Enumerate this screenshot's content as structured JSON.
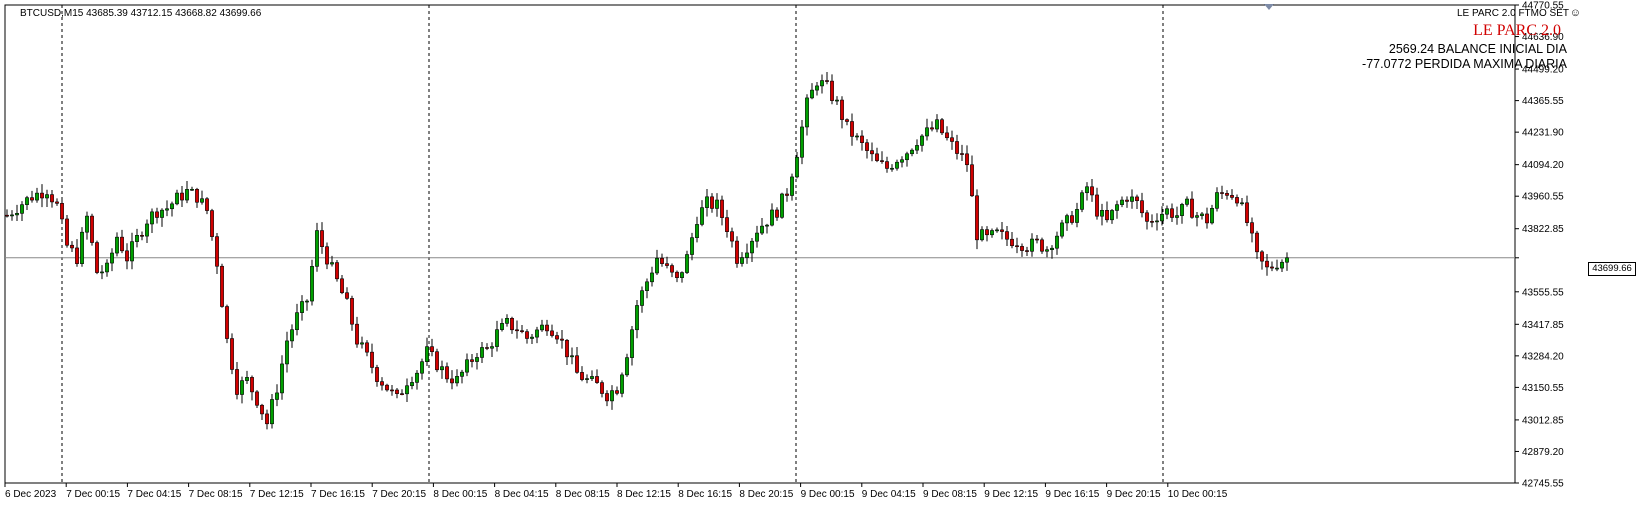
{
  "header": {
    "symbol_info": "BTCUSD,M15  43685.39 43712.15 43668.82 43699.66",
    "ea_label": "LE PARC 2.0 FTMO SET",
    "ea_title": "LE PARC 2.0",
    "balance_line": "2569.24 BALANCE INICIAL DIA",
    "loss_line": "-77.0772 PERDIDA MAXIMA DIARIA",
    "smiley_icon": "smiley-face-icon"
  },
  "colors": {
    "bull": "#00a000",
    "bear": "#d10000",
    "wick": "#000000",
    "grid": "#000000",
    "current_price_line": "#888888",
    "ea_title": "#d10000"
  },
  "chart_data": {
    "type": "candlestick",
    "symbol": "BTCUSD",
    "timeframe": "M15",
    "ylim": [
      42745.55,
      44770.55
    ],
    "y_ticks": [
      "44770.55",
      "44636.90",
      "44499.20",
      "44365.55",
      "44231.90",
      "44094.20",
      "43960.55",
      "43822.85",
      "43699.66",
      "43555.55",
      "43417.85",
      "43284.20",
      "43150.55",
      "43012.85",
      "42879.20",
      "42745.55"
    ],
    "x_tick_labels": [
      "6 Dec 2023",
      "7 Dec 00:15",
      "7 Dec 04:15",
      "7 Dec 08:15",
      "7 Dec 12:15",
      "7 Dec 16:15",
      "7 Dec 20:15",
      "8 Dec 00:15",
      "8 Dec 04:15",
      "8 Dec 08:15",
      "8 Dec 12:15",
      "8 Dec 16:15",
      "8 Dec 20:15",
      "9 Dec 00:15",
      "9 Dec 04:15",
      "9 Dec 08:15",
      "9 Dec 12:15",
      "9 Dec 16:15",
      "9 Dec 20:15",
      "10 Dec 00:15"
    ],
    "day_separators": [
      "7 Dec 00:00",
      "8 Dec 00:00",
      "9 Dec 00:00",
      "10 Dec 00:00"
    ],
    "current_price": 43699.66,
    "grid": false,
    "close_path": [
      [
        0,
        43880
      ],
      [
        3,
        43930
      ],
      [
        5,
        43960
      ],
      [
        8,
        43990
      ],
      [
        10,
        43920
      ],
      [
        12,
        43750
      ],
      [
        14,
        43700
      ],
      [
        16,
        43870
      ],
      [
        18,
        43640
      ],
      [
        20,
        43650
      ],
      [
        22,
        43790
      ],
      [
        24,
        43700
      ],
      [
        26,
        43780
      ],
      [
        28,
        43860
      ],
      [
        30,
        43900
      ],
      [
        32,
        43910
      ],
      [
        34,
        43950
      ],
      [
        36,
        43980
      ],
      [
        38,
        43960
      ],
      [
        40,
        43900
      ],
      [
        42,
        43680
      ],
      [
        44,
        43350
      ],
      [
        46,
        43150
      ],
      [
        48,
        43180
      ],
      [
        50,
        43100
      ],
      [
        52,
        43000
      ],
      [
        54,
        43150
      ],
      [
        56,
        43350
      ],
      [
        58,
        43450
      ],
      [
        60,
        43520
      ],
      [
        62,
        43800
      ],
      [
        64,
        43700
      ],
      [
        66,
        43600
      ],
      [
        68,
        43500
      ],
      [
        70,
        43350
      ],
      [
        72,
        43280
      ],
      [
        74,
        43200
      ],
      [
        76,
        43150
      ],
      [
        78,
        43100
      ],
      [
        80,
        43180
      ],
      [
        82,
        43220
      ],
      [
        84,
        43300
      ],
      [
        86,
        43250
      ],
      [
        88,
        43200
      ],
      [
        90,
        43180
      ],
      [
        92,
        43240
      ],
      [
        94,
        43300
      ],
      [
        96,
        43310
      ],
      [
        98,
        43380
      ],
      [
        100,
        43420
      ],
      [
        102,
        43400
      ],
      [
        104,
        43360
      ],
      [
        106,
        43390
      ],
      [
        108,
        43420
      ],
      [
        110,
        43380
      ],
      [
        112,
        43300
      ],
      [
        114,
        43210
      ],
      [
        116,
        43180
      ],
      [
        118,
        43160
      ],
      [
        120,
        43120
      ],
      [
        122,
        43150
      ],
      [
        124,
        43300
      ],
      [
        126,
        43500
      ],
      [
        128,
        43600
      ],
      [
        130,
        43700
      ],
      [
        132,
        43650
      ],
      [
        134,
        43600
      ],
      [
        136,
        43700
      ],
      [
        138,
        43870
      ],
      [
        140,
        43930
      ],
      [
        142,
        43920
      ],
      [
        144,
        43830
      ],
      [
        146,
        43700
      ],
      [
        148,
        43750
      ],
      [
        150,
        43820
      ],
      [
        152,
        43860
      ],
      [
        154,
        43900
      ],
      [
        156,
        43980
      ],
      [
        158,
        44150
      ],
      [
        160,
        44350
      ],
      [
        162,
        44450
      ],
      [
        164,
        44420
      ],
      [
        166,
        44350
      ],
      [
        168,
        44250
      ],
      [
        170,
        44200
      ],
      [
        172,
        44150
      ],
      [
        174,
        44100
      ],
      [
        176,
        44080
      ],
      [
        178,
        44120
      ],
      [
        180,
        44150
      ],
      [
        182,
        44200
      ],
      [
        184,
        44230
      ],
      [
        186,
        44260
      ],
      [
        188,
        44200
      ],
      [
        190,
        44150
      ],
      [
        192,
        44100
      ],
      [
        194,
        43800
      ],
      [
        196,
        43780
      ],
      [
        198,
        43800
      ],
      [
        200,
        43780
      ],
      [
        202,
        43770
      ],
      [
        204,
        43750
      ],
      [
        206,
        43760
      ],
      [
        208,
        43740
      ],
      [
        210,
        43800
      ],
      [
        212,
        43850
      ],
      [
        214,
        43900
      ],
      [
        216,
        44000
      ],
      [
        218,
        43900
      ],
      [
        220,
        43850
      ],
      [
        222,
        43920
      ],
      [
        224,
        43960
      ],
      [
        226,
        43930
      ],
      [
        228,
        43850
      ],
      [
        230,
        43880
      ],
      [
        232,
        43900
      ],
      [
        234,
        43880
      ],
      [
        236,
        43920
      ],
      [
        238,
        43880
      ],
      [
        240,
        43860
      ],
      [
        242,
        43960
      ],
      [
        244,
        43980
      ],
      [
        246,
        43960
      ],
      [
        248,
        43850
      ],
      [
        250,
        43700
      ],
      [
        252,
        43650
      ],
      [
        254,
        43680
      ],
      [
        256,
        43699.66
      ]
    ]
  }
}
